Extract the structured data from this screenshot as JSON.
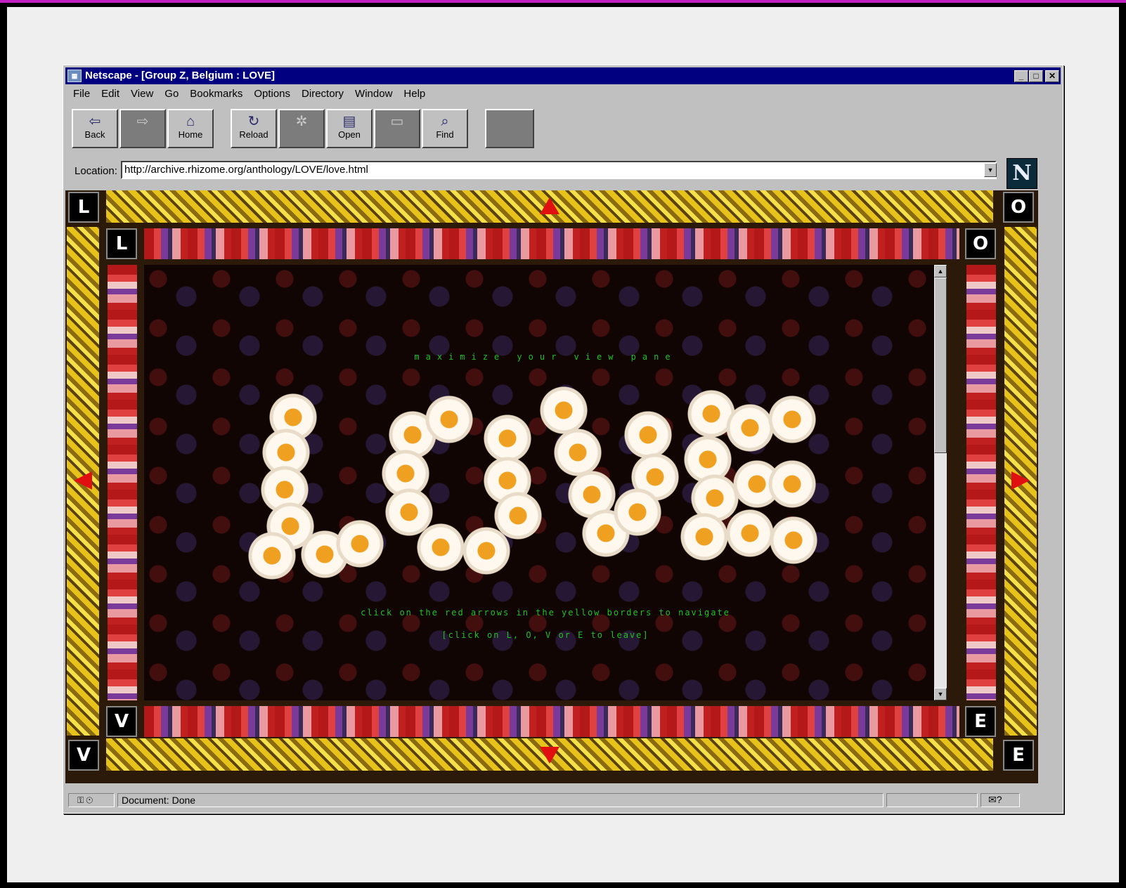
{
  "window": {
    "title": "Netscape - [Group Z, Belgium : LOVE]",
    "controls": [
      "_",
      "□",
      "✕"
    ]
  },
  "menu": [
    "File",
    "Edit",
    "View",
    "Go",
    "Bookmarks",
    "Options",
    "Directory",
    "Window",
    "Help"
  ],
  "toolbar": {
    "back": {
      "label": "Back",
      "icon": "back-arrow-icon",
      "glyph": "⇦"
    },
    "forward": {
      "label": "",
      "icon": "forward-arrow-icon",
      "glyph": "⇨"
    },
    "home": {
      "label": "Home",
      "icon": "home-icon",
      "glyph": "⌂"
    },
    "reload": {
      "label": "Reload",
      "icon": "reload-icon",
      "glyph": "↻"
    },
    "images": {
      "label": "",
      "icon": "images-icon",
      "glyph": "✲"
    },
    "open": {
      "label": "Open",
      "icon": "open-icon",
      "glyph": "▤"
    },
    "print": {
      "label": "",
      "icon": "print-icon",
      "glyph": "▭"
    },
    "find": {
      "label": "Find",
      "icon": "find-binoculars-icon",
      "glyph": "⌕"
    },
    "stop": {
      "label": "",
      "icon": "stop-icon"
    }
  },
  "location": {
    "label": "Location:",
    "url": "http://archive.rhizome.org/anthology/LOVE/love.html"
  },
  "logo": {
    "letter": "N"
  },
  "page": {
    "corner_letters": [
      "L",
      "O",
      "V",
      "E"
    ],
    "instruction_top": "maximize your view pane",
    "instruction_nav": "click on the red arrows in the yellow borders to navigate",
    "instruction_leave": "[click on L, O, V or E to leave]",
    "artwork_word": "LOVE"
  },
  "status": {
    "text": "Document: Done"
  },
  "colors": {
    "title_bar": "#000080",
    "message_green": "#20c020",
    "nav_arrow_red": "#e01010"
  }
}
